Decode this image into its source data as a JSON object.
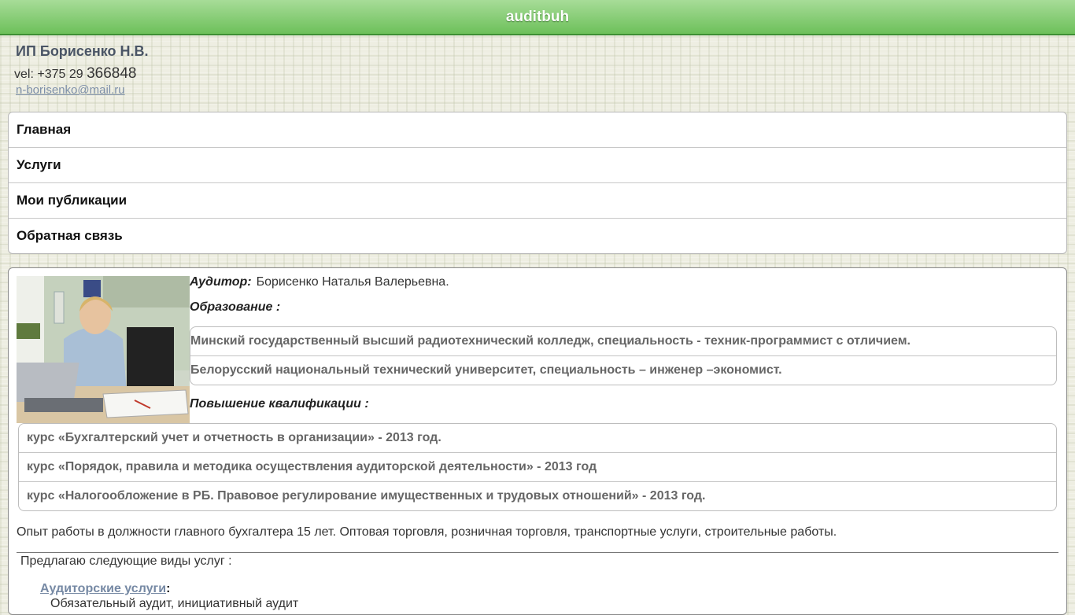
{
  "site": {
    "title": "auditbuh"
  },
  "header": {
    "company": "ИП Борисенко Н.В.",
    "phone_prefix": "vel: +375 29",
    "phone_number": "366848",
    "email": "n-borisenko@mail.ru"
  },
  "nav": {
    "items": [
      {
        "label": "Главная"
      },
      {
        "label": "Услуги"
      },
      {
        "label": "Мои публикации"
      },
      {
        "label": "Обратная связь"
      }
    ]
  },
  "profile": {
    "auditor_label": "Аудитор:",
    "auditor_name": "Борисенко Наталья Валерьевна.",
    "education_label": "Образование :",
    "education": [
      "Минский государственный высший радиотехнический колледж, специальность - техник-программист с отличием.",
      "Белорусский национальный технический университет, специальность – инженер –экономист."
    ],
    "qualification_label": "Повышение квалификации :",
    "courses": [
      "курс «Бухгалтерский учет и отчетность в организации» - 2013 год.",
      "курс «Порядок, правила и методика осуществления аудиторской деятельности» - 2013 год",
      "курс «Налогообложение в РБ. Правовое регулирование имущественных и трудовых отношений» - 2013 год."
    ],
    "experience": "Опыт работы в должности главного бухгалтера 15 лет. Оптовая торговля, розничная торговля, транспортные услуги, строительные работы.",
    "offer_intro": "Предлагаю следующие виды услуг :",
    "service_link": "Аудиторские услуги",
    "service_colon": ":",
    "service_sub": "Обязательный аудит, инициативный аудит"
  }
}
